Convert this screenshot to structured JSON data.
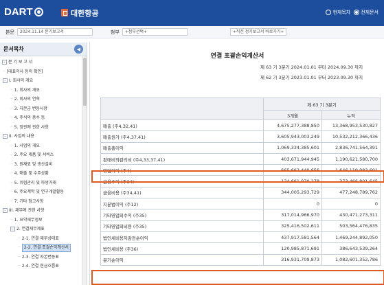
{
  "header": {
    "logo_text": "DART",
    "company_name": "대한항공",
    "radio_current": "현재목차",
    "radio_all": "전체문서"
  },
  "filter": {
    "report_label": "본문",
    "report_value": "2024.11.14  분기보고서",
    "attach_label": "첨부",
    "attach_value": "+첨부선택+",
    "recent_value": "+직전 정기보고서 바로가기+"
  },
  "sidebar": {
    "title": "문서목차",
    "items": [
      {
        "label": "분 기 보 고 서",
        "indent": 0,
        "toggle": "-"
      },
      {
        "label": "[대표이사 등의 확인]",
        "indent": 1,
        "toggle": ""
      },
      {
        "label": "I. 회사의 개요",
        "indent": 1,
        "toggle": "-"
      },
      {
        "label": "1. 회사의 개요",
        "indent": 2,
        "toggle": ""
      },
      {
        "label": "2. 회사의 연혁",
        "indent": 2,
        "toggle": ""
      },
      {
        "label": "3. 자본금 변동사항",
        "indent": 2,
        "toggle": ""
      },
      {
        "label": "4. 주식의 총수 등",
        "indent": 2,
        "toggle": ""
      },
      {
        "label": "5. 정관에 관한 사항",
        "indent": 2,
        "toggle": ""
      },
      {
        "label": "II. 사업의 내용",
        "indent": 1,
        "toggle": "-"
      },
      {
        "label": "1. 사업의 개요",
        "indent": 2,
        "toggle": ""
      },
      {
        "label": "2. 주요 제품 및 서비스",
        "indent": 2,
        "toggle": ""
      },
      {
        "label": "3. 원재료 및 생산설비",
        "indent": 2,
        "toggle": ""
      },
      {
        "label": "4. 매출 및 수주상황",
        "indent": 2,
        "toggle": ""
      },
      {
        "label": "5. 위험관리 및 파생거래",
        "indent": 2,
        "toggle": ""
      },
      {
        "label": "6. 주요계약 및 연구개발활동",
        "indent": 2,
        "toggle": ""
      },
      {
        "label": "7. 기타 참고사항",
        "indent": 2,
        "toggle": ""
      },
      {
        "label": "III. 재무에 관한 사항",
        "indent": 1,
        "toggle": "-"
      },
      {
        "label": "1. 요약재무정보",
        "indent": 2,
        "toggle": ""
      },
      {
        "label": "2. 연결재무제표",
        "indent": 2,
        "toggle": "-"
      },
      {
        "label": "2-1. 연결 재무상태표",
        "indent": 3,
        "toggle": ""
      },
      {
        "label": "2-2. 연결 포괄손익계산서",
        "indent": 3,
        "toggle": "",
        "selected": true
      },
      {
        "label": "2-3. 연결 자본변동표",
        "indent": 3,
        "toggle": ""
      },
      {
        "label": "2-4. 연결 현금흐름표",
        "indent": 3,
        "toggle": ""
      }
    ]
  },
  "main": {
    "title": "연결 포괄손익계산서",
    "period1": "제 63 기 3분기 2024.01.01 부터 2024.09.30 까지",
    "period2": "제 62 기 3분기 2023.01.01 부터 2023.09.30 까지",
    "col_group": "제 63 기 3분기",
    "col_3m": "3개월",
    "col_cum": "누적",
    "rows": [
      {
        "name": "매출 (주4,32,41)",
        "q3": "4,675,277,388,850",
        "cum": "13,368,953,530,827"
      },
      {
        "name": "매출원가 (주4,37,41)",
        "q3": "3,605,943,003,249",
        "cum": "10,532,212,366,436"
      },
      {
        "name": "매출총이익",
        "q3": "1,069,334,385,601",
        "cum": "2,836,741,564,391"
      },
      {
        "name": "판매비와관리비 (주4,33,37,41)",
        "q3": "403,671,944,945",
        "cum": "1,190,621,580,700"
      },
      {
        "name": "영업이익 (주4)",
        "q3": "665,662,440,656",
        "cum": "1,646,119,983,691"
      },
      {
        "name": "금융수익 (주34)",
        "q3": "124,661,970,278",
        "cum": "373,466,801,645"
      },
      {
        "name": "금융비용 (주34,41)",
        "q3": "344,005,293,729",
        "cum": "477,248,789,762"
      },
      {
        "name": "지분법이익 (주12)",
        "q3": "0",
        "cum": "0"
      },
      {
        "name": "기타영업외수익 (주35)",
        "q3": "317,014,966,970",
        "cum": "430,471,273,311"
      },
      {
        "name": "기타영업외비용 (주35)",
        "q3": "325,416,502,611",
        "cum": "503,564,476,835"
      },
      {
        "name": "법인세비용차감전순이익",
        "q3": "437,917,581,564",
        "cum": "1,469,244,892,050"
      },
      {
        "name": "법인세비용 (주36)",
        "q3": "120,985,871,691",
        "cum": "386,643,539,264"
      },
      {
        "name": "분기순이익",
        "q3": "316,931,709,873",
        "cum": "1,082,601,352,786"
      }
    ]
  }
}
